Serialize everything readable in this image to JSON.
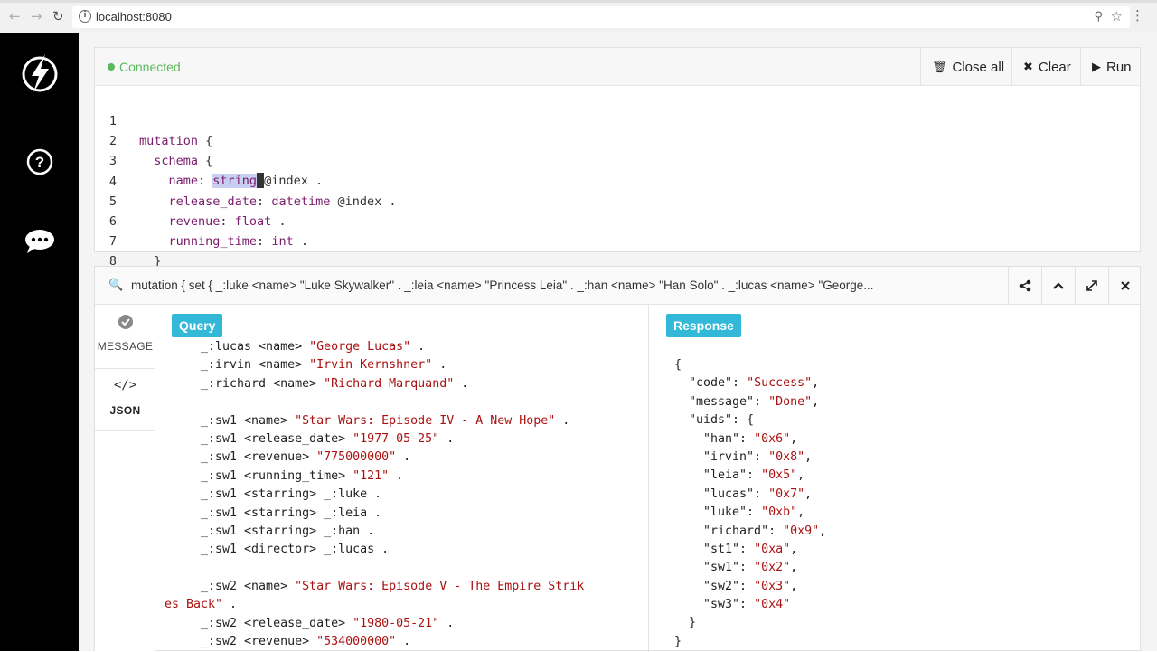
{
  "browser": {
    "url": "localhost:8080"
  },
  "editor": {
    "status": "Connected",
    "buttons": {
      "close_all": "Close all",
      "clear": "Clear",
      "run": "Run"
    },
    "line_numbers": [
      "1",
      "2",
      "3",
      "4",
      "5",
      "6",
      "7",
      "8"
    ],
    "lines": [
      {
        "key": "mutation",
        "rest": " {"
      },
      {
        "key": "  schema",
        "rest": " {"
      },
      {
        "key": "    name",
        "rest": ": "
      },
      {
        "key": "    release_date",
        "rest": ": "
      },
      {
        "key": "    revenue",
        "rest": ": "
      },
      {
        "key": "    running_time",
        "rest": ": "
      },
      {
        "key": "  }",
        "rest": ""
      },
      {
        "key": "}",
        "rest": ""
      }
    ],
    "types": {
      "l3": "string",
      "l4": "datetime",
      "l5": "float",
      "l6": "int"
    },
    "directives": {
      "l3": "@index .",
      "l4": " @index .",
      "l5": " .",
      "l6": " ."
    }
  },
  "result": {
    "query_summary": "mutation { set { _:luke <name> \"Luke Skywalker\" . _:leia <name> \"Princess Leia\" . _:han <name> \"Han Solo\" . _:lucas <name> \"George...",
    "tabs": {
      "message": "MESSAGE",
      "json": "JSON"
    },
    "query_label": "Query",
    "response_label": "Response",
    "query_lines": [
      {
        "p": "  _:lucas <name> ",
        "s": "\"George Lucas\"",
        "e": " ."
      },
      {
        "p": "  _:irvin <name> ",
        "s": "\"Irvin Kernshner\"",
        "e": " ."
      },
      {
        "p": "  _:richard <name> ",
        "s": "\"Richard Marquand\"",
        "e": " ."
      },
      {
        "p": "",
        "s": "",
        "e": ""
      },
      {
        "p": "  _:sw1 <name> ",
        "s": "\"Star Wars: Episode IV - A New Hope\"",
        "e": " ."
      },
      {
        "p": "  _:sw1 <release_date> ",
        "s": "\"1977-05-25\"",
        "e": " ."
      },
      {
        "p": "  _:sw1 <revenue> ",
        "s": "\"775000000\"",
        "e": " ."
      },
      {
        "p": "  _:sw1 <running_time> ",
        "s": "\"121\"",
        "e": " ."
      },
      {
        "p": "  _:sw1 <starring> _:luke .",
        "s": "",
        "e": ""
      },
      {
        "p": "  _:sw1 <starring> _:leia .",
        "s": "",
        "e": ""
      },
      {
        "p": "  _:sw1 <starring> _:han .",
        "s": "",
        "e": ""
      },
      {
        "p": "  _:sw1 <director> _:lucas .",
        "s": "",
        "e": ""
      },
      {
        "p": "",
        "s": "",
        "e": ""
      },
      {
        "p": "  _:sw2 <name> ",
        "s": "\"Star Wars: Episode V - The Empire Strik",
        "e": ""
      },
      {
        "p": "",
        "s": "es Back\"",
        "e": " ."
      },
      {
        "p": "  _:sw2 <release_date> ",
        "s": "\"1980-05-21\"",
        "e": " ."
      },
      {
        "p": "  _:sw2 <revenue> ",
        "s": "\"534000000\"",
        "e": " ."
      }
    ],
    "response_lines": [
      {
        "p": "{",
        "s": "",
        "e": ""
      },
      {
        "p": "  \"code\": ",
        "s": "\"Success\"",
        "e": ","
      },
      {
        "p": "  \"message\": ",
        "s": "\"Done\"",
        "e": ","
      },
      {
        "p": "  \"uids\": {",
        "s": "",
        "e": ""
      },
      {
        "p": "    \"han\": ",
        "s": "\"0x6\"",
        "e": ","
      },
      {
        "p": "    \"irvin\": ",
        "s": "\"0x8\"",
        "e": ","
      },
      {
        "p": "    \"leia\": ",
        "s": "\"0x5\"",
        "e": ","
      },
      {
        "p": "    \"lucas\": ",
        "s": "\"0x7\"",
        "e": ","
      },
      {
        "p": "    \"luke\": ",
        "s": "\"0xb\"",
        "e": ","
      },
      {
        "p": "    \"richard\": ",
        "s": "\"0x9\"",
        "e": ","
      },
      {
        "p": "    \"st1\": ",
        "s": "\"0xa\"",
        "e": ","
      },
      {
        "p": "    \"sw1\": ",
        "s": "\"0x2\"",
        "e": ","
      },
      {
        "p": "    \"sw2\": ",
        "s": "\"0x3\"",
        "e": ","
      },
      {
        "p": "    \"sw3\": ",
        "s": "\"0x4\"",
        "e": ""
      },
      {
        "p": "  }",
        "s": "",
        "e": ""
      },
      {
        "p": "}",
        "s": "",
        "e": ""
      }
    ]
  },
  "colors": {
    "connected": "#5cb85c",
    "pill": "#33b8d8",
    "keyword": "#7a1c6c",
    "string": "#a11"
  },
  "icons": {
    "sidebar": [
      "dgraph-logo-icon",
      "help-icon",
      "chat-icon"
    ],
    "header": [
      "search-icon",
      "share-icon",
      "chevron-up-icon",
      "expand-icon",
      "close-icon"
    ]
  }
}
